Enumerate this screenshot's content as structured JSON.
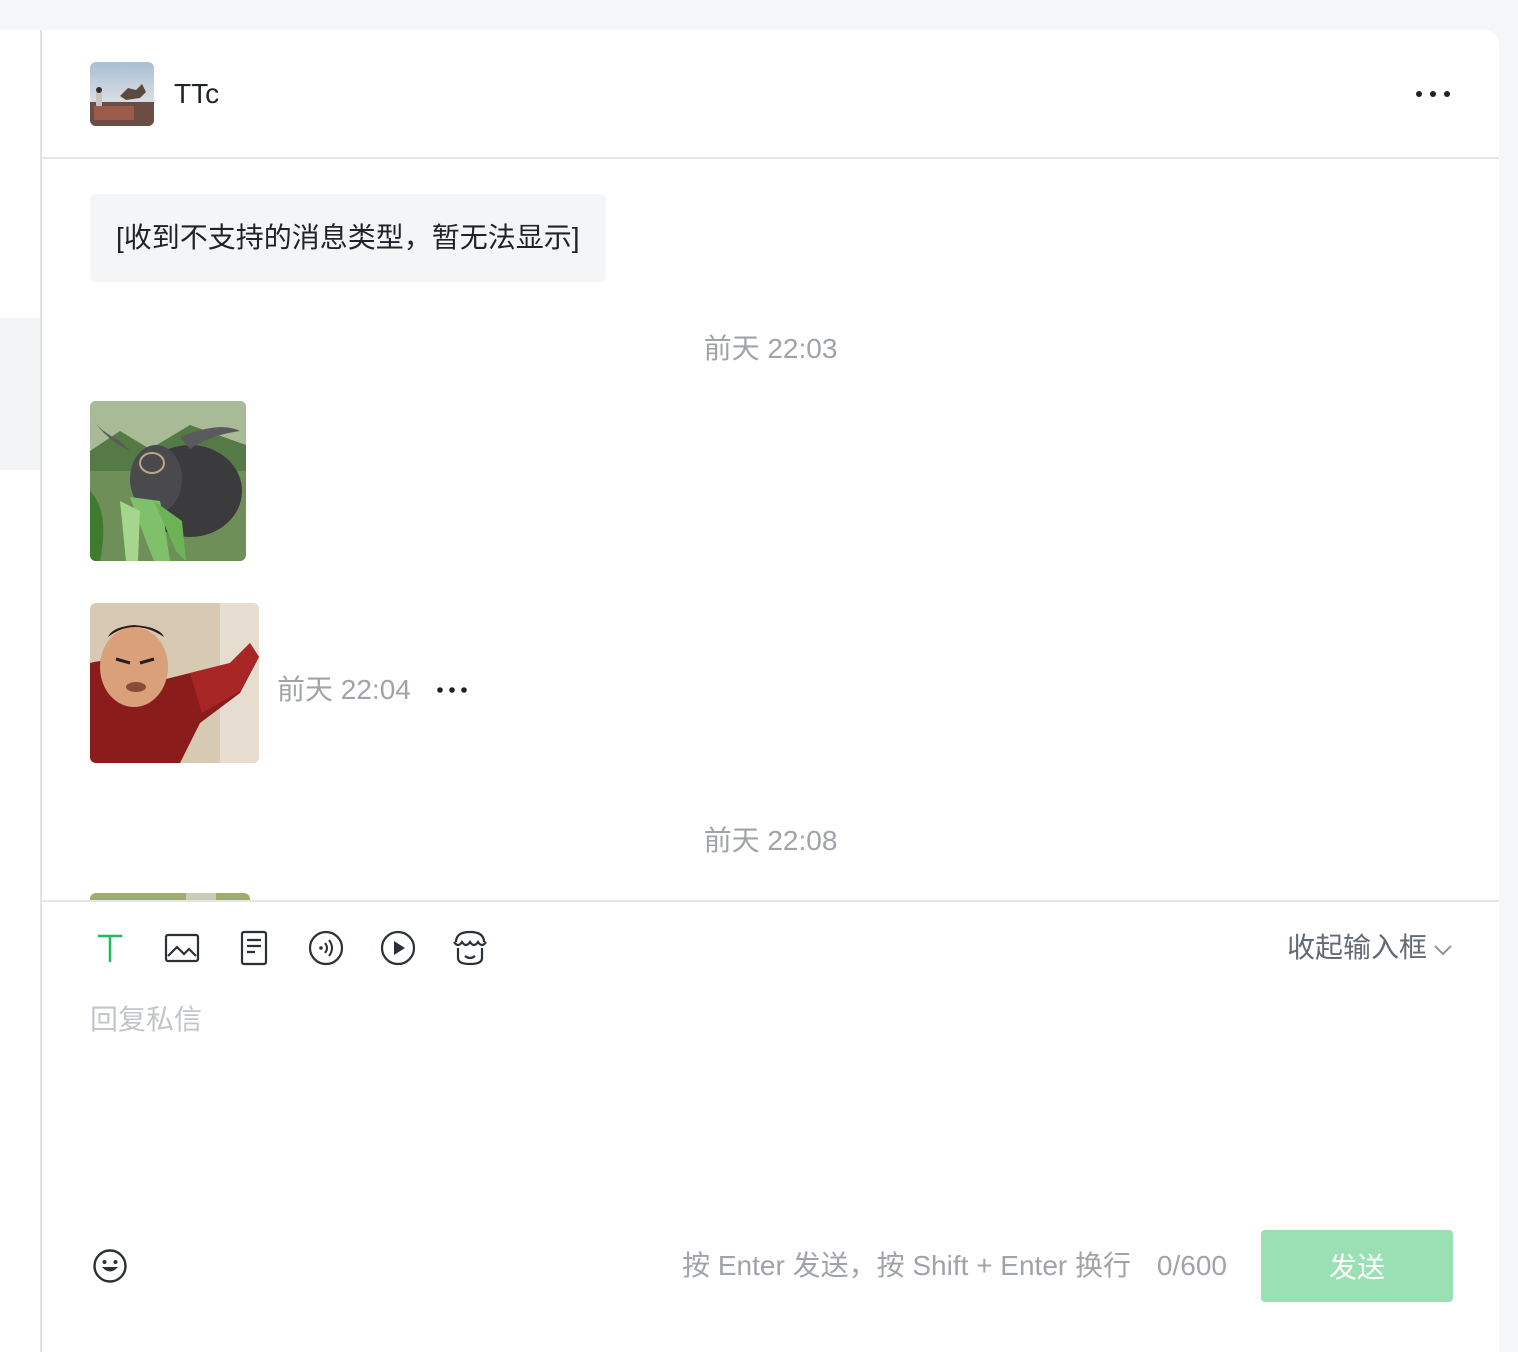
{
  "header": {
    "contact_name": "TTc",
    "more_icon": "more-horizontal-icon"
  },
  "messages": {
    "unsupported_text": "[收到不支持的消息类型，暂无法显示]",
    "timestamp_1": "前天 22:03",
    "inline_timestamp": "前天 22:04",
    "timestamp_2": "前天 22:08",
    "image_1": "water buffer eating grass photo",
    "image_2": "man in red sweater meme photo"
  },
  "composer": {
    "tools": [
      "text-icon",
      "image-icon",
      "file-icon",
      "audio-icon",
      "video-icon",
      "shop-icon"
    ],
    "collapse_label": "收起输入框",
    "placeholder": "回复私信",
    "hint": "按 Enter 发送，按 Shift + Enter 换行",
    "counter": "0/600",
    "send_label": "发送",
    "emoji_icon": "emoji-icon"
  },
  "colors": {
    "accent": "#1fba5a",
    "send_disabled": "#9ae0b4",
    "muted_text": "#a0a3a8"
  }
}
